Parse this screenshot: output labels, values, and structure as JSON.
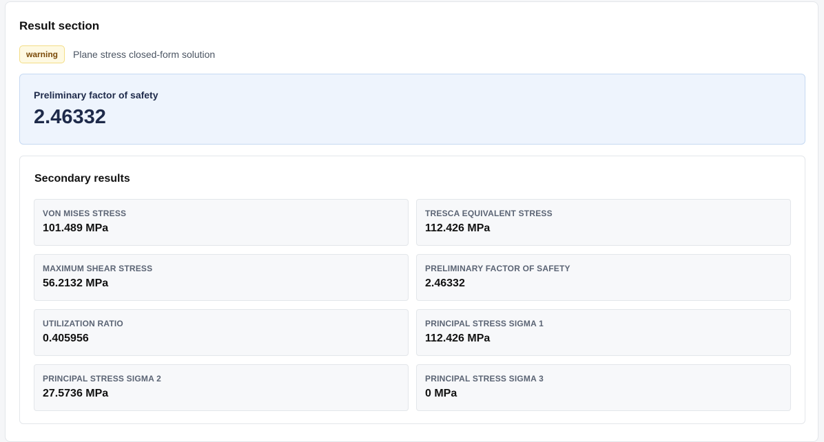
{
  "result": {
    "title": "Result section",
    "badge": "warning",
    "method": "Plane stress closed-form solution",
    "primary": {
      "label": "Preliminary factor of safety",
      "value": "2.46332"
    },
    "secondary": {
      "title": "Secondary results",
      "metrics": [
        {
          "label": "VON MISES STRESS",
          "value": "101.489 MPa"
        },
        {
          "label": "TRESCA EQUIVALENT STRESS",
          "value": "112.426 MPa"
        },
        {
          "label": "MAXIMUM SHEAR STRESS",
          "value": "56.2132 MPa"
        },
        {
          "label": "PRELIMINARY FACTOR OF SAFETY",
          "value": "2.46332"
        },
        {
          "label": "UTILIZATION RATIO",
          "value": "0.405956"
        },
        {
          "label": "PRINCIPAL STRESS SIGMA 1",
          "value": "112.426 MPa"
        },
        {
          "label": "PRINCIPAL STRESS SIGMA 2",
          "value": "27.5736 MPa"
        },
        {
          "label": "PRINCIPAL STRESS SIGMA 3",
          "value": "0 MPa"
        }
      ]
    }
  },
  "colors": {
    "badge_bg": "#fef9e2",
    "badge_border": "#f3dd85",
    "badge_text": "#7a4a08",
    "primary_bg": "#eef4fd",
    "primary_border": "#c6d9f2",
    "primary_text": "#1e2a4a"
  }
}
